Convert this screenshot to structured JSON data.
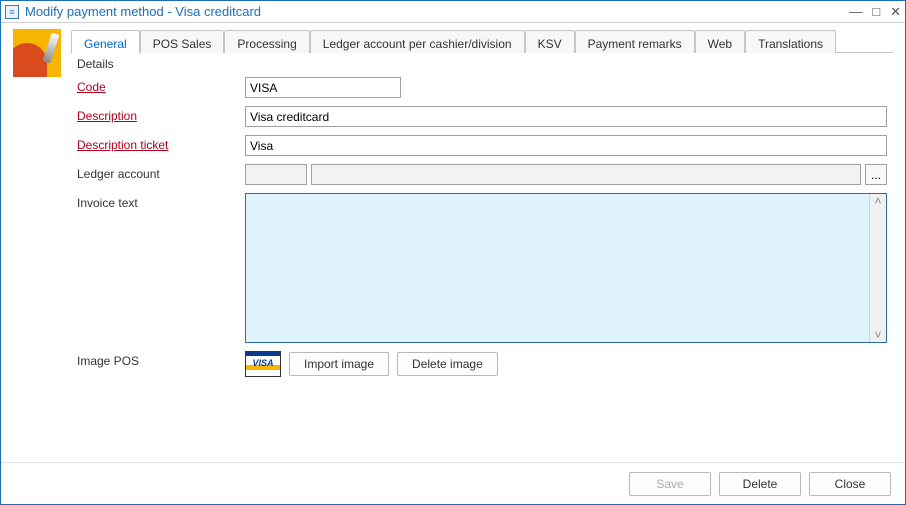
{
  "window": {
    "title": "Modify payment method - Visa creditcard"
  },
  "tabs": [
    {
      "label": "General"
    },
    {
      "label": "POS Sales"
    },
    {
      "label": "Processing"
    },
    {
      "label": "Ledger account per cashier/division"
    },
    {
      "label": "KSV"
    },
    {
      "label": "Payment remarks"
    },
    {
      "label": "Web"
    },
    {
      "label": "Translations"
    }
  ],
  "section": {
    "title": "Details"
  },
  "fields": {
    "code": {
      "label": "Code",
      "value": "VISA"
    },
    "description": {
      "label": "Description",
      "value": "Visa creditcard"
    },
    "description_ticket": {
      "label": "Description ticket",
      "value": "Visa"
    },
    "ledger_account": {
      "label": "Ledger account",
      "code": "",
      "name": ""
    },
    "invoice_text": {
      "label": "Invoice text",
      "value": ""
    },
    "image_pos": {
      "label": "Image POS",
      "thumb_text": "VISA"
    }
  },
  "buttons": {
    "ellipsis": "...",
    "import_image": "Import image",
    "delete_image": "Delete image",
    "save": "Save",
    "delete": "Delete",
    "close": "Close"
  }
}
